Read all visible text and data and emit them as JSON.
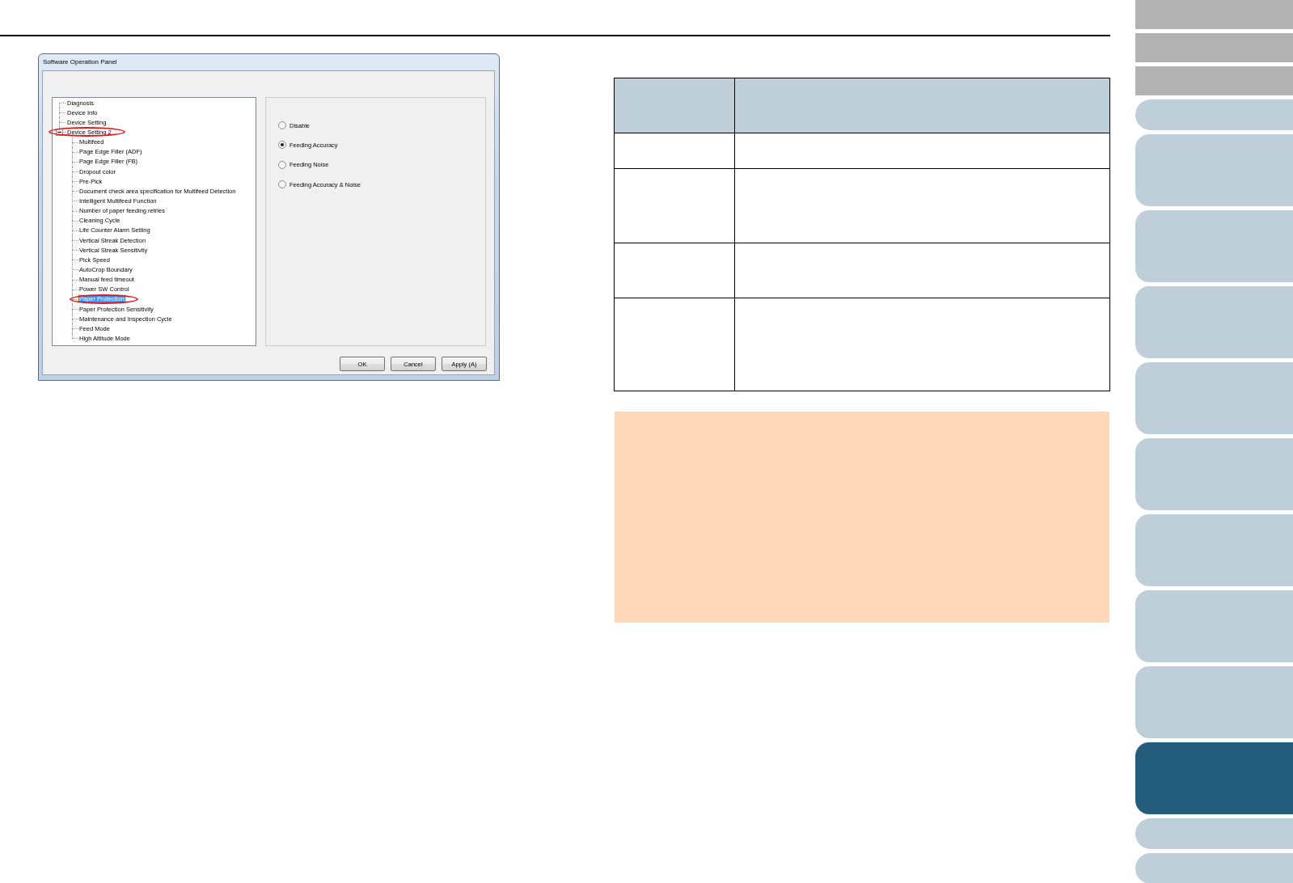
{
  "dialog": {
    "title": "Software Operation Panel",
    "tree": [
      {
        "label": "Diagnosis",
        "selected": false,
        "circled": false
      },
      {
        "label": "Device Info",
        "selected": false,
        "circled": false
      },
      {
        "label": "Device Setting",
        "selected": false,
        "circled": false
      },
      {
        "label": "Device Setting 2",
        "selected": false,
        "circled": true,
        "expanded": true,
        "children": [
          {
            "label": "Multifeed",
            "selected": false,
            "circled": false
          },
          {
            "label": "Page Edge Filler (ADF)",
            "selected": false,
            "circled": false
          },
          {
            "label": "Page Edge Filler (FB)",
            "selected": false,
            "circled": false
          },
          {
            "label": "Dropout color",
            "selected": false,
            "circled": false
          },
          {
            "label": "Pre-Pick",
            "selected": false,
            "circled": false
          },
          {
            "label": "Document check area specification for Multifeed Detection",
            "selected": false,
            "circled": false
          },
          {
            "label": "Intelligent Multifeed Function",
            "selected": false,
            "circled": false
          },
          {
            "label": "Number of paper feeding retries",
            "selected": false,
            "circled": false
          },
          {
            "label": "Cleaning Cycle",
            "selected": false,
            "circled": false
          },
          {
            "label": "Life Counter Alarm Setting",
            "selected": false,
            "circled": false
          },
          {
            "label": "Vertical Streak Detection",
            "selected": false,
            "circled": false
          },
          {
            "label": "Vertical Streak Sensitivity",
            "selected": false,
            "circled": false
          },
          {
            "label": "Pick Speed",
            "selected": false,
            "circled": false
          },
          {
            "label": "AutoCrop Boundary",
            "selected": false,
            "circled": false
          },
          {
            "label": "Manual feed timeout",
            "selected": false,
            "circled": false
          },
          {
            "label": "Power SW Control",
            "selected": false,
            "circled": false
          },
          {
            "label": "Paper Protection",
            "selected": true,
            "circled": true
          },
          {
            "label": "Paper Protection Sensitivity",
            "selected": false,
            "circled": false
          },
          {
            "label": "Maintenance and Inspection Cycle",
            "selected": false,
            "circled": false
          },
          {
            "label": "Feed Mode",
            "selected": false,
            "circled": false
          },
          {
            "label": "High Altitude Mode",
            "selected": false,
            "circled": false
          }
        ]
      }
    ],
    "options": [
      {
        "label": "Disable",
        "selected": false
      },
      {
        "label": "Feeding Accuracy",
        "selected": true
      },
      {
        "label": "Feeding Noise",
        "selected": false
      },
      {
        "label": "Feeding Accuracy & Noise",
        "selected": false
      }
    ],
    "buttons": [
      "OK",
      "Cancel",
      "Apply (A)"
    ]
  },
  "content": [
    {
      "kind": "table",
      "rows": [
        {
          "kind": "header"
        },
        {
          "kind": "row"
        },
        {
          "kind": "row"
        },
        {
          "kind": "row"
        },
        {
          "kind": "row"
        }
      ]
    },
    {
      "kind": "note"
    }
  ],
  "sidebar": {
    "tabs": [
      {
        "kind": "block",
        "selected": false
      },
      {
        "kind": "block",
        "selected": false
      },
      {
        "kind": "block",
        "selected": false
      },
      {
        "kind": "short",
        "selected": false
      },
      {
        "kind": "tall",
        "selected": false
      },
      {
        "kind": "tall",
        "selected": false
      },
      {
        "kind": "tall",
        "selected": false
      },
      {
        "kind": "tall",
        "selected": false
      },
      {
        "kind": "tall",
        "selected": false
      },
      {
        "kind": "tall",
        "selected": false
      },
      {
        "kind": "tall",
        "selected": false
      },
      {
        "kind": "tall",
        "selected": false
      },
      {
        "kind": "tall",
        "selected": true
      },
      {
        "kind": "short",
        "selected": false
      },
      {
        "kind": "short",
        "selected": false
      }
    ]
  }
}
